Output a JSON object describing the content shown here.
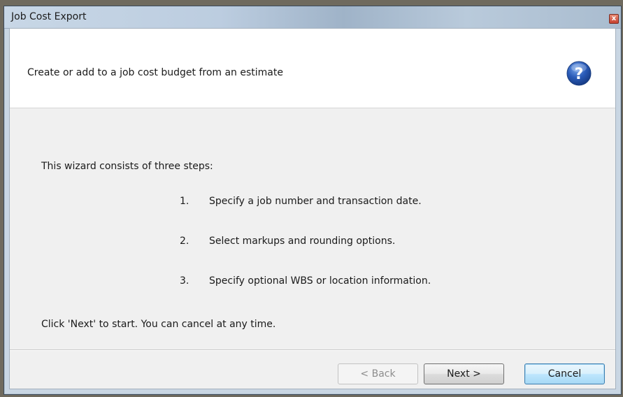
{
  "window": {
    "title": "Job Cost Export",
    "close_label": "x"
  },
  "header": {
    "text": "Create or add to a job cost budget from an estimate",
    "help_icon": "question-mark-circle",
    "help_icon_color": "#2a5bb8"
  },
  "body": {
    "intro": "This wizard consists of three steps:",
    "steps": [
      {
        "num": "1.",
        "text": "Specify a job number and transaction date."
      },
      {
        "num": "2.",
        "text": "Select markups and rounding options."
      },
      {
        "num": "3.",
        "text": "Specify optional WBS or location information."
      }
    ],
    "outro": "Click 'Next' to start. You can cancel at any time."
  },
  "buttons": {
    "back": "< Back",
    "next": "Next >",
    "cancel": "Cancel"
  }
}
